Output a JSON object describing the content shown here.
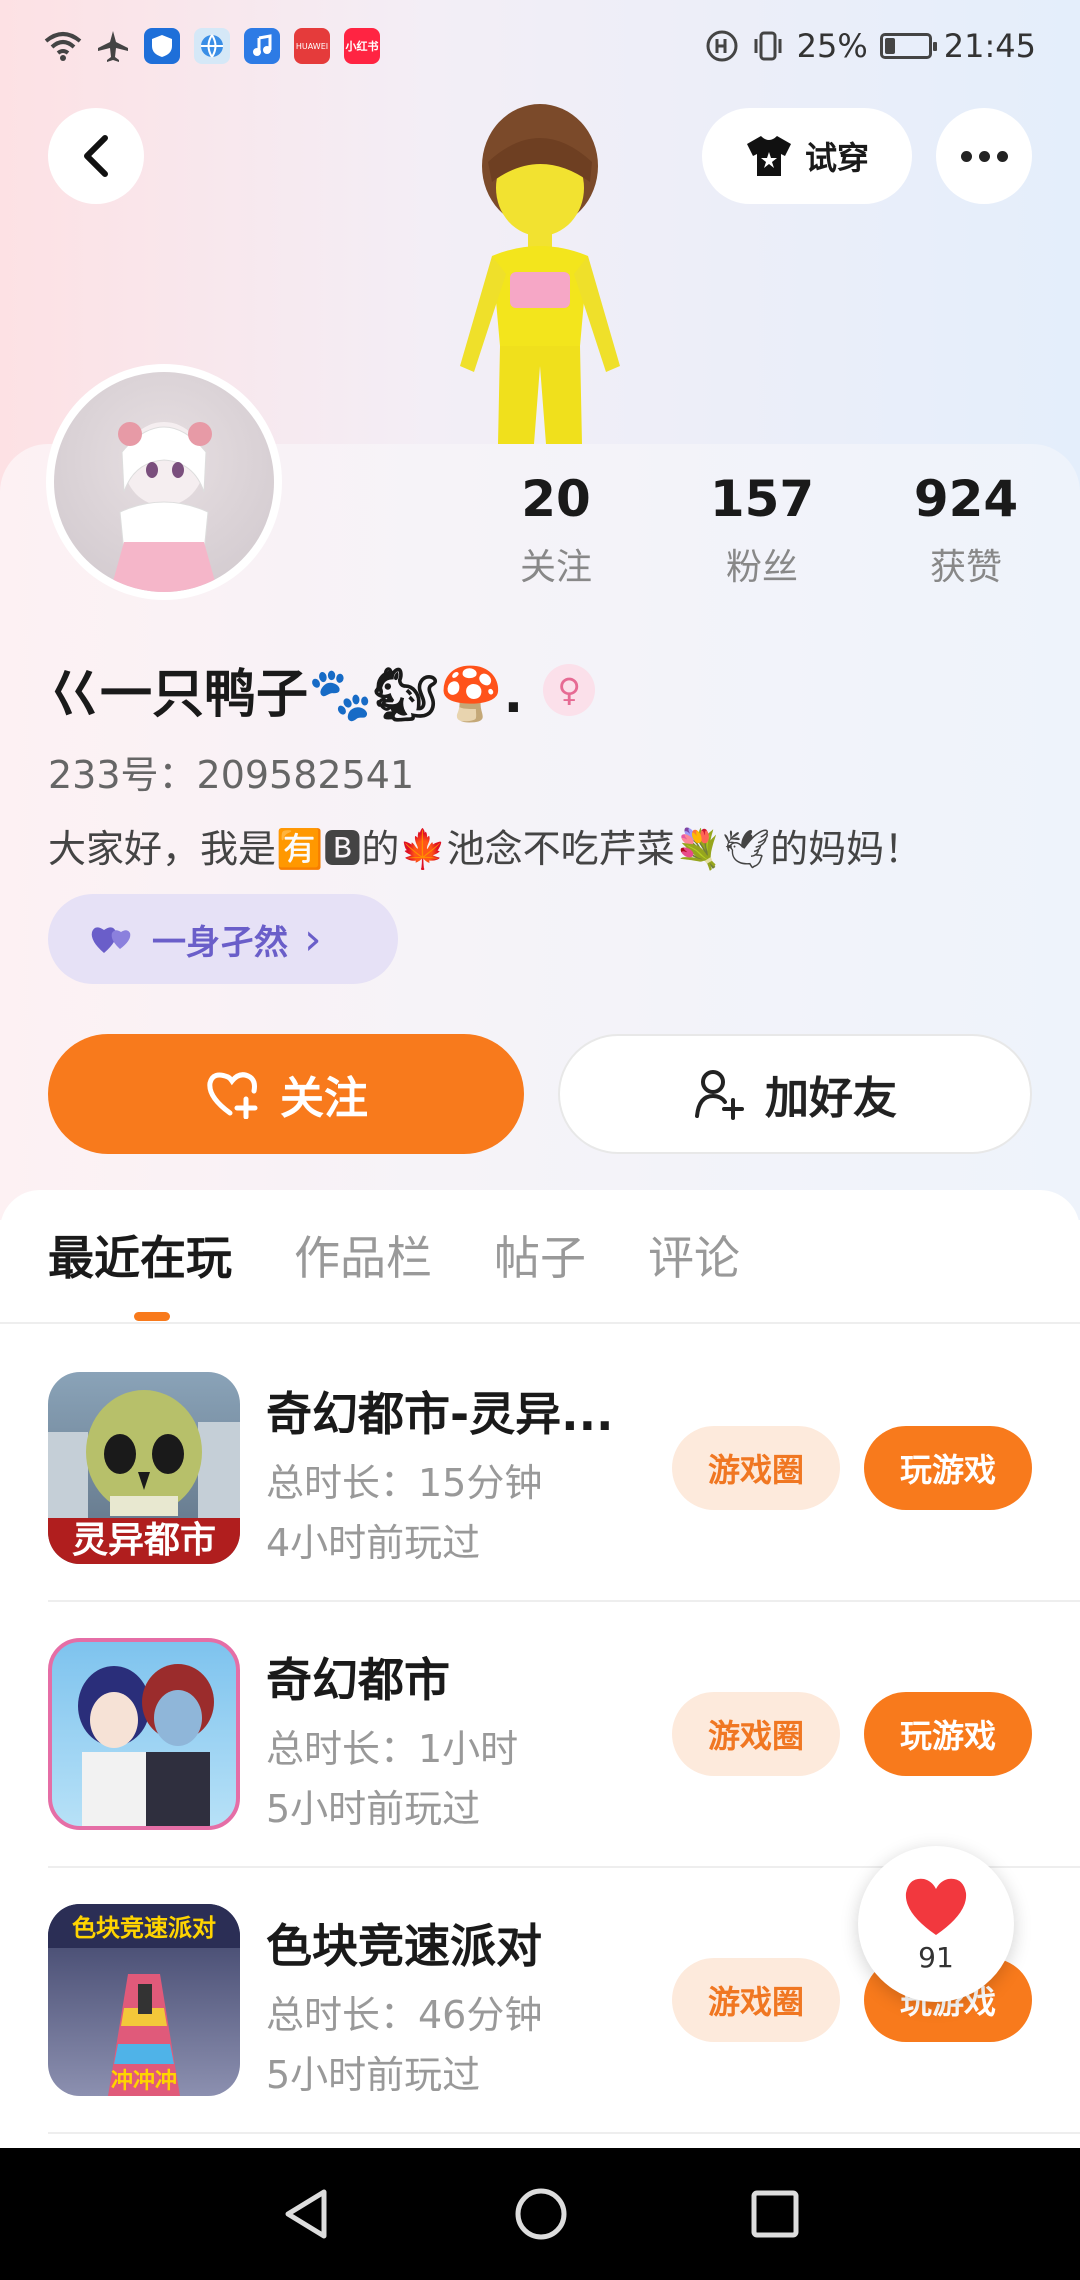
{
  "status_bar": {
    "battery": "25%",
    "battery_level": 0.25,
    "time": "21:45",
    "huawei_label": "HUAWEI",
    "redbook_label": "小红书"
  },
  "header": {
    "tryon_label": "试穿"
  },
  "profile": {
    "stats": [
      {
        "value": "20",
        "label": "关注"
      },
      {
        "value": "157",
        "label": "粉丝"
      },
      {
        "value": "924",
        "label": "获赞"
      }
    ],
    "nickname": "巜一只鸭子🐾🐿🍄.",
    "gender_icon": "♀",
    "uid": "233号：209582541",
    "bio": "大家好，我是🈶🅱的🍁池念不吃芹菜💐🕊的妈妈！",
    "tag": "一身孑然",
    "tag_chevron": "›",
    "follow_label": "关注",
    "add_friend_label": "加好友"
  },
  "tabs": [
    {
      "label": "最近在玩",
      "active": true
    },
    {
      "label": "作品栏",
      "active": false
    },
    {
      "label": "帖子",
      "active": false
    },
    {
      "label": "评论",
      "active": false
    }
  ],
  "games": [
    {
      "title": "奇幻都市-灵异...",
      "duration": "总时长：15分钟",
      "last_played": "4小时前玩过",
      "icon_text": "灵异都市",
      "circle_label": "游戏圈",
      "play_label": "玩游戏"
    },
    {
      "title": "奇幻都市",
      "duration": "总时长：1小时",
      "last_played": "5小时前玩过",
      "icon_text": "",
      "circle_label": "游戏圈",
      "play_label": "玩游戏"
    },
    {
      "title": "色块竞速派对",
      "duration": "总时长：46分钟",
      "last_played": "5小时前玩过",
      "icon_text": "色块竞速派对",
      "icon_text2": "冲冲冲",
      "circle_label": "游戏圈",
      "play_label": "玩游戏"
    }
  ],
  "floating_like": {
    "count": "91"
  },
  "colors": {
    "accent": "#f87a1c",
    "tag_purple": "#6a5ec9"
  }
}
